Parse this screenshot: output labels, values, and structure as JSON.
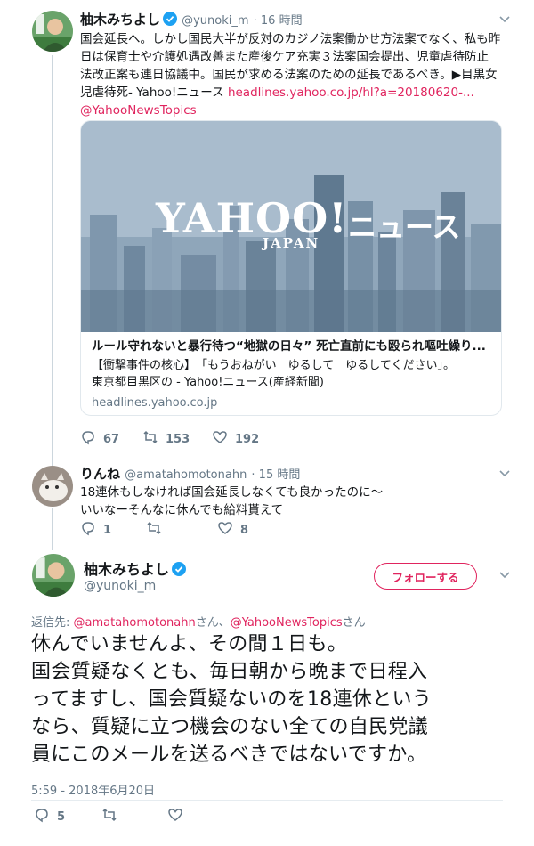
{
  "tweet1": {
    "name": "柚木みちよし",
    "handle": "@yunoki_m",
    "time": "· 16 時間",
    "text_line1": "国会延長へ。しかし国民大半が反対のカジノ法案働かせ方法案でなく、私も昨",
    "text_line2": "日は保育士や介護処遇改善また産後ケア充実３法案国会提出、児童虐待防止",
    "text_line3": "法改正案も連日協議中。国民が求める法案のための延長であるべき。▶目黒女",
    "text_line4_prefix": "児虐待死- Yahoo!ニュース ",
    "text_link": "headlines.yahoo.co.jp/hl?a=20180620-...",
    "text_mention": "@YahooNewsTopics",
    "card": {
      "logo_main": "YAHOO!",
      "logo_sub": "JAPAN",
      "logo_news": "ニュース",
      "title": "ルール守れないと暴行待つ“地獄の日々” 死亡直前にも殴られ嘔吐繰り...",
      "desc_line1": "【衝撃事件の核心】　「もうおねがい　ゆるして　ゆるしてください」。",
      "desc_line2": "東京都目黒区の - Yahoo!ニュース(産経新聞)",
      "domain": "headlines.yahoo.co.jp"
    },
    "replies": "67",
    "retweets": "153",
    "likes": "192"
  },
  "tweet2": {
    "name": "りんね",
    "handle": "@amatahomotonahn",
    "time": "· 15 時間",
    "text_line1": "18連休もしなければ国会延長しなくても良かったのに〜",
    "text_line2": "いいなーそんなに休んでも給料貰えて",
    "replies": "1",
    "retweets": "",
    "likes": "8"
  },
  "tweet3": {
    "name": "柚木みちよし",
    "handle": "@yunoki_m",
    "follow_label": "フォローする",
    "reply_to_label": "返信先: ",
    "reply_to_user1": "@amatahomotonahn",
    "reply_to_san1": "さん、",
    "reply_to_user2": "@YahooNewsTopics",
    "reply_to_san2": "さん",
    "text_line1": "休んでいませんよ、その間１日も。",
    "text_line2": "国会質疑なくとも、毎日朝から晩まで日程入",
    "text_line3": "ってますし、国会質疑ないのを18連休という",
    "text_line4": "なら、質疑に立つ機会のない全ての自民党議",
    "text_line5": "員にこのメールを送るべきではないですか。",
    "timestamp": "5:59 - 2018年6月20日",
    "replies": "5",
    "retweets": "",
    "likes": ""
  },
  "colors": {
    "accent": "#e0245e",
    "verified": "#1da1f2",
    "muted": "#657786",
    "thread_line": "#ccd6dd"
  }
}
